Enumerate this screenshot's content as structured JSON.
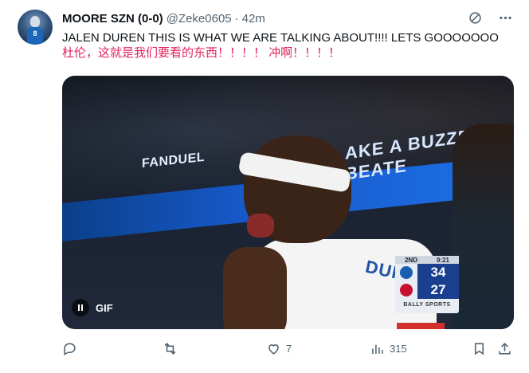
{
  "tweet": {
    "author": {
      "display_name": "MOORE SZN (0-0)",
      "handle": "@Zeke0605",
      "avatar_jersey_number": "8"
    },
    "separator": "·",
    "time": "42m",
    "text_en": "JALEN DUREN THIS IS WHAT WE ARE TALKING ABOUT!!!! LETS GOOOOOOO",
    "text_cn": "杜伦，这就是我们要看的东西！！！！ 冲啊！！！！",
    "media": {
      "type": "GIF",
      "gif_label": "GIF",
      "banner_left": "FANDUEL",
      "banner_right": "AKE A BUZZER BEATE",
      "jersey_name": "DUREN",
      "scoreboard": {
        "period": "2ND",
        "clock": "9:21",
        "home_score": "34",
        "away_score": "27",
        "network": "BALLY SPORTS"
      }
    },
    "metrics": {
      "replies": "",
      "retweets": "",
      "likes": "7",
      "views": "315"
    }
  },
  "colors": {
    "text_primary": "#0f1419",
    "text_secondary": "#536471",
    "chinese_text": "#e0245e",
    "banner": "#1659c9"
  },
  "icons": [
    "grok-icon",
    "more-icon",
    "reply-icon",
    "retweet-icon",
    "like-icon",
    "views-icon",
    "bookmark-icon",
    "share-icon"
  ]
}
